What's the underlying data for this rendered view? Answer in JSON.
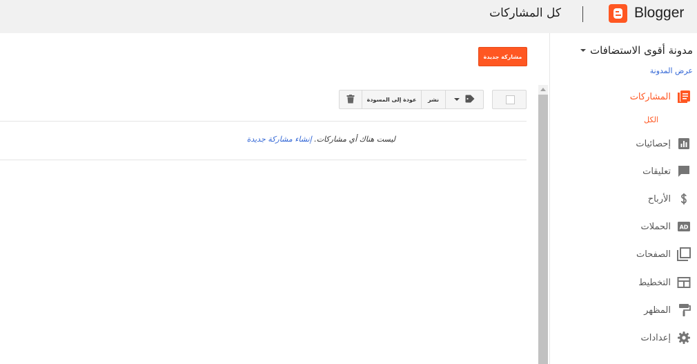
{
  "header": {
    "brand": "Blogger",
    "title": "كل المشاركات"
  },
  "sidebar": {
    "blog_title": "مدونة أقوى الاستضافات",
    "view_blog": "عرض المدونة",
    "sub_all": "الكل",
    "items": [
      {
        "label": "المشاركات",
        "icon": "posts-icon",
        "active": true
      },
      {
        "label": "إحصائيات",
        "icon": "stats-icon"
      },
      {
        "label": "تعليقات",
        "icon": "comment-icon"
      },
      {
        "label": "الأرباح",
        "icon": "dollar-icon"
      },
      {
        "label": "الحملات",
        "icon": "ad-icon"
      },
      {
        "label": "الصفحات",
        "icon": "pages-icon"
      },
      {
        "label": "التخطيط",
        "icon": "layout-icon"
      },
      {
        "label": "المظهر",
        "icon": "paint-roller-icon"
      },
      {
        "label": "إعدادات",
        "icon": "gear-icon"
      }
    ]
  },
  "main": {
    "new_post_label": "مشاركة جديدة",
    "toolbar": {
      "publish_label": "نشر",
      "revert_label": "عودة إلى المسودة"
    },
    "empty_text": "ليست هناك أي مشاركات.",
    "create_link": "إنشاء مشاركة جديدة"
  },
  "colors": {
    "accent": "#ff5722",
    "link": "#3367d6",
    "header_bg": "#f1f1f1"
  }
}
